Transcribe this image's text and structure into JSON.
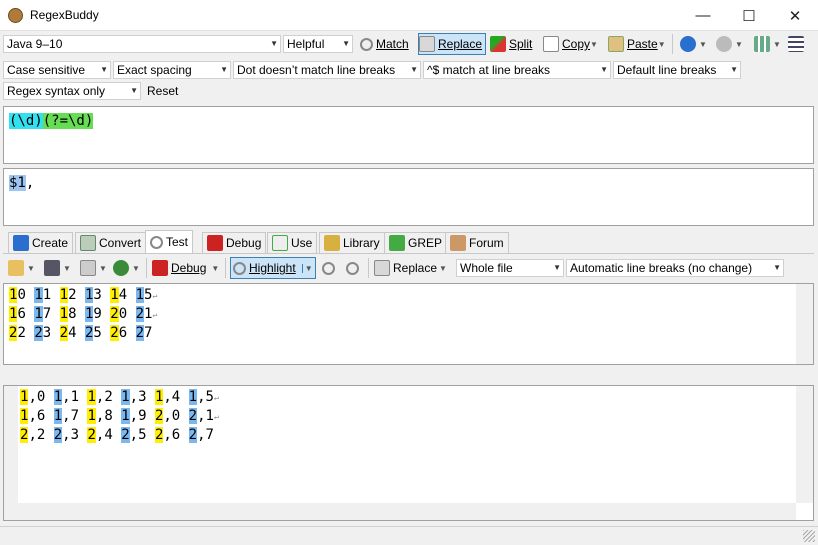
{
  "window": {
    "title": "RegexBuddy"
  },
  "toolbar1": {
    "flavor": "Java 9–10",
    "helpful": "Helpful",
    "match": "Match",
    "replace": "Replace",
    "split": "Split",
    "copy": "Copy",
    "paste": "Paste"
  },
  "options": {
    "case": "Case sensitive",
    "spacing": "Exact spacing",
    "dot": "Dot doesn’t match line breaks",
    "anchors": "^$ match at line breaks",
    "linebreaks": "Default line breaks",
    "syntax": "Regex syntax only",
    "reset": "Reset"
  },
  "regex": {
    "group1": "(\\d)",
    "lookahead": "(?=\\d)"
  },
  "replacement": {
    "token": "$1",
    "rest": ","
  },
  "tabs": [
    "Create",
    "Convert",
    "Test",
    "Debug",
    "Use",
    "Library",
    "GREP",
    "Forum"
  ],
  "test_toolbar": {
    "debug": "Debug",
    "highlight": "Highlight",
    "replace": "Replace",
    "scope": "Whole file",
    "linebreaks": "Automatic line breaks (no change)"
  },
  "subject_lines": [
    [
      "10",
      "11",
      "12",
      "13",
      "14",
      "15"
    ],
    [
      "16",
      "17",
      "18",
      "19",
      "20",
      "21"
    ],
    [
      "22",
      "23",
      "24",
      "25",
      "26",
      "27"
    ]
  ],
  "result_lines": [
    [
      "1,0",
      "1,1",
      "1,2",
      "1,3",
      "1,4",
      "1,5"
    ],
    [
      "1,6",
      "1,7",
      "1,8",
      "1,9",
      "2,0",
      "2,1"
    ],
    [
      "2,2",
      "2,3",
      "2,4",
      "2,5",
      "2,6",
      "2,7"
    ]
  ],
  "colors": {
    "match_yellow": "#ffee00",
    "match_blue": "#7cb8f0",
    "group_cyan": "#33e0f0",
    "lookahead_green": "#66dd55",
    "token_blue": "#9ec4f0"
  }
}
